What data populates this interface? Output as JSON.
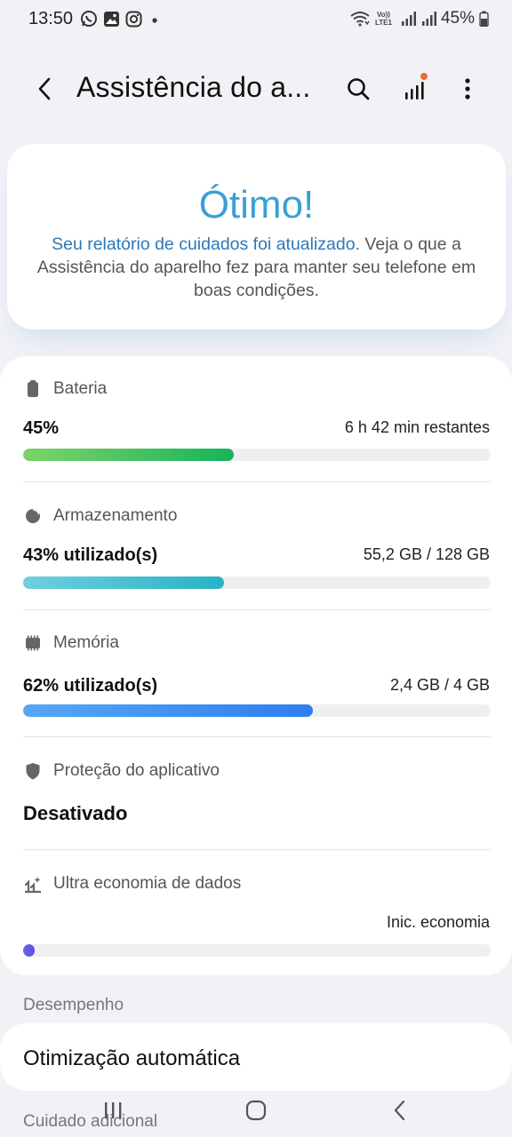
{
  "status_bar": {
    "time": "13:50",
    "battery_percent": "45%",
    "notification_icons": [
      "whatsapp-icon",
      "gallery-icon",
      "instagram-icon",
      "dot-icon"
    ],
    "system_icons": [
      "wifi-icon",
      "volte-lte-icon",
      "signal-icon",
      "signal-icon",
      "battery-icon"
    ]
  },
  "app_bar": {
    "title": "Assistência do a...",
    "icons": [
      "back-icon",
      "search-icon",
      "report-icon",
      "more-icon"
    ]
  },
  "summary": {
    "title": "Ótimo!",
    "link_text": "Seu relatório de cuidados foi atualizado.",
    "body_text": " Veja o que a Assistência do aparelho fez para manter seu telefone em boas condições."
  },
  "status": {
    "battery": {
      "label": "Bateria",
      "value": "45%",
      "detail": "6 h 42 min restantes",
      "fraction": 0.45,
      "color_from": "#7fd36a",
      "color_to": "#16b45a"
    },
    "storage": {
      "label": "Armazenamento",
      "value": "43% utilizado(s)",
      "detail": "55,2 GB / 128 GB",
      "fraction": 0.43,
      "color_from": "#6fcfe0",
      "color_to": "#29b2c6"
    },
    "memory": {
      "label": "Memória",
      "value": "62% utilizado(s)",
      "detail": "2,4 GB / 4 GB",
      "fraction": 0.62,
      "color_from": "#55a8f2",
      "color_to": "#2f7ef0"
    },
    "app_protection": {
      "label": "Proteção do aplicativo",
      "value": "Desativado"
    },
    "data_saver": {
      "label": "Ultra economia de dados",
      "detail": "Inic. economia",
      "fraction": 0.025,
      "color_from": "#6b63e8",
      "color_to": "#5a52e0"
    }
  },
  "performance": {
    "header": "Desempenho",
    "item": "Otimização automática"
  },
  "extra": {
    "header": "Cuidado adicional"
  },
  "nav_bar": {
    "icons": [
      "recents-icon",
      "home-icon",
      "back-nav-icon"
    ]
  }
}
